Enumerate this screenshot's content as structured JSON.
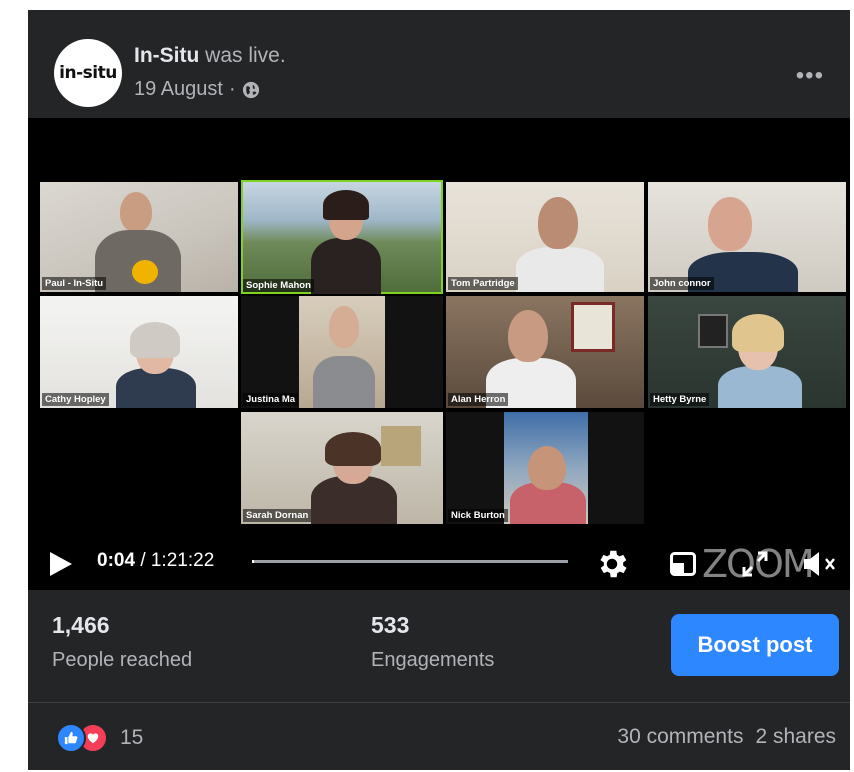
{
  "post": {
    "author": "In-Situ",
    "action": "was live.",
    "date": "19 August",
    "separator": "·",
    "avatar_text": "in-situ",
    "more_icon": "more-horizontal-icon"
  },
  "video": {
    "participants": [
      {
        "name": "Paul - In-Situ"
      },
      {
        "name": "Sophie Mahon",
        "active": true
      },
      {
        "name": "Tom Partridge"
      },
      {
        "name": "John connor"
      },
      {
        "name": "Cathy Hopley"
      },
      {
        "name": "Justina Ma"
      },
      {
        "name": "Alan Herron"
      },
      {
        "name": "Hetty Byrne"
      },
      {
        "name": "Sarah Dornan"
      },
      {
        "name": "Nick Burton"
      }
    ],
    "current_time": "0:04",
    "duration": "/ 1:21:22",
    "progress": 0.0008,
    "watermark": "ZOOM",
    "active_color": "#7ed321"
  },
  "stats": {
    "reached_value": "1,466",
    "reached_label": "People reached",
    "engagements_value": "533",
    "engagements_label": "Engagements",
    "boost_label": "Boost post",
    "boost_color": "#2d88ff"
  },
  "footer": {
    "reaction_count": "15",
    "comments": "30 comments",
    "shares": "2 shares"
  }
}
